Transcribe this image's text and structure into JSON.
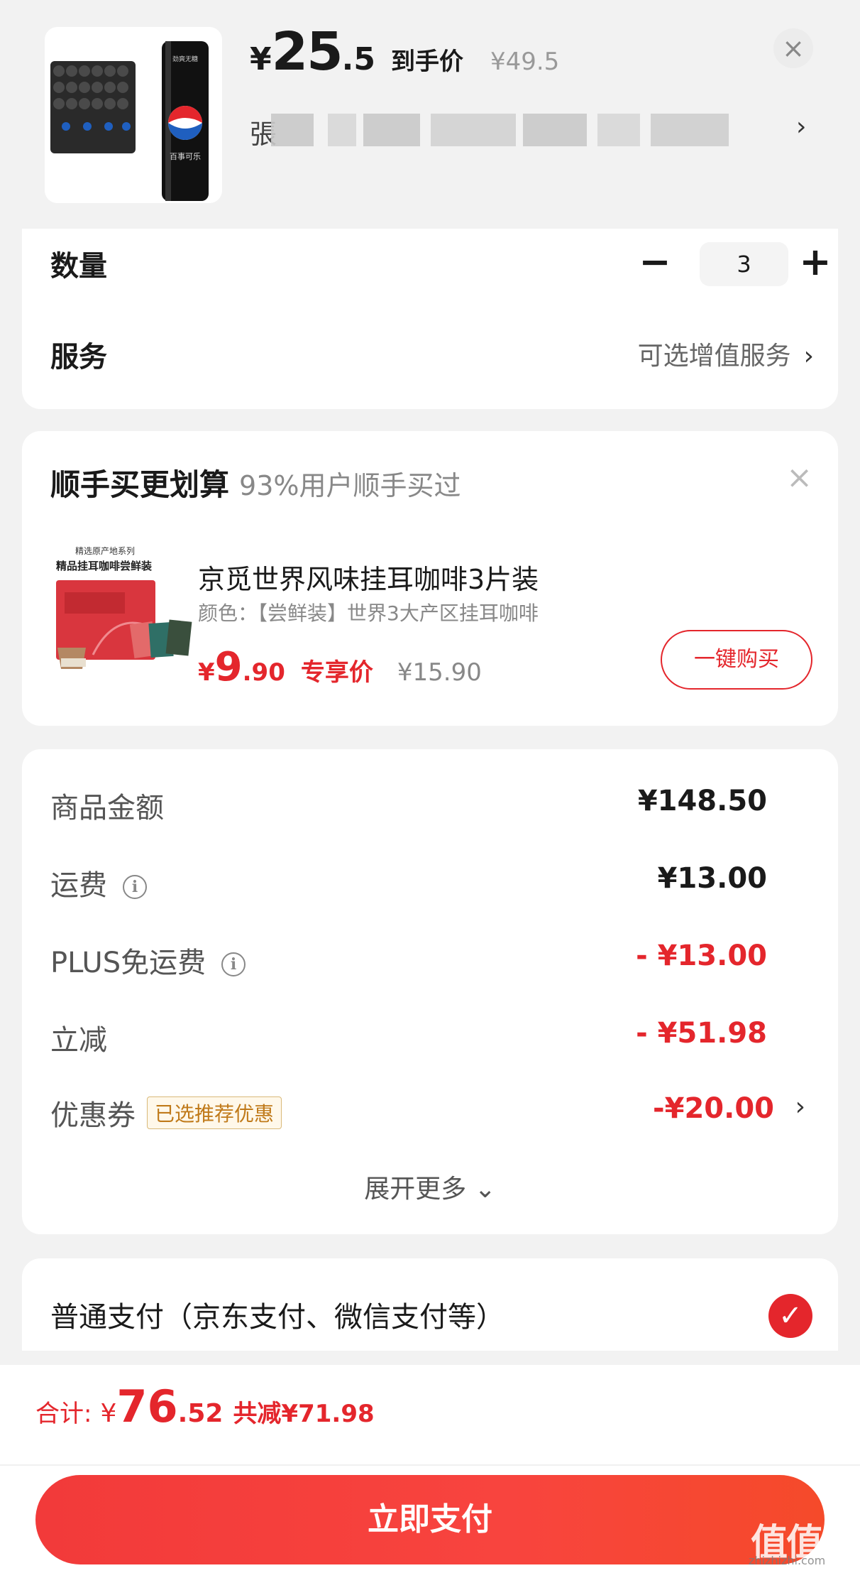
{
  "product": {
    "price_yen": "¥",
    "price_int": "25",
    "price_dec": ".5",
    "price_tag": "到手价",
    "original_price": "¥49.5",
    "spec_first_char": "張",
    "close_label": "×",
    "chevron": "›",
    "can_brand_top": "劲爽无糖",
    "can_brand_name": "百事可乐"
  },
  "quantity": {
    "label": "数量",
    "minus": "−",
    "value": "3",
    "plus": "+"
  },
  "service": {
    "label": "服务",
    "link": "可选增值服务",
    "chevron": "›"
  },
  "upsell": {
    "title": "顺手买更划算",
    "subtitle": "93%用户顺手买过",
    "close": "×",
    "image_line1": "精选原产地系列",
    "image_line2": "精品挂耳咖啡尝鲜装",
    "name": "京觅世界风味挂耳咖啡3片装",
    "spec": "颜色：【尝鲜装】世界3大产区挂耳咖啡",
    "price_yen": "¥",
    "price_int": "9",
    "price_dec": ".90",
    "price_tag": "专享价",
    "original_price": "¥15.90",
    "buy_button": "一键购买"
  },
  "fees": {
    "rows": [
      {
        "label": "商品金额",
        "value": "¥148.50"
      },
      {
        "label": "运费",
        "value": "¥13.00",
        "info": "i"
      },
      {
        "label": "PLUS免运费",
        "value": "- ¥13.00",
        "info": "i"
      },
      {
        "label": "立减",
        "value": "- ¥51.98"
      },
      {
        "label": "优惠券",
        "tag": "已选推荐优惠",
        "value": "-¥20.00",
        "chevron": "›"
      }
    ],
    "expand": "展开更多 ⌄"
  },
  "payment": {
    "label": "普通支付（京东支付、微信支付等）",
    "check": "✓"
  },
  "summary": {
    "label": "合计:",
    "yen": "¥",
    "total_int": "76",
    "total_dec": ".52",
    "saved": "共减¥71.98",
    "pay_button": "立即支付"
  },
  "watermark": {
    "big": "值值值",
    "small": "zhizhizhi.com"
  },
  "colors": {
    "accent": "#e4262c",
    "background": "#f2f2f2",
    "card": "#ffffff"
  }
}
